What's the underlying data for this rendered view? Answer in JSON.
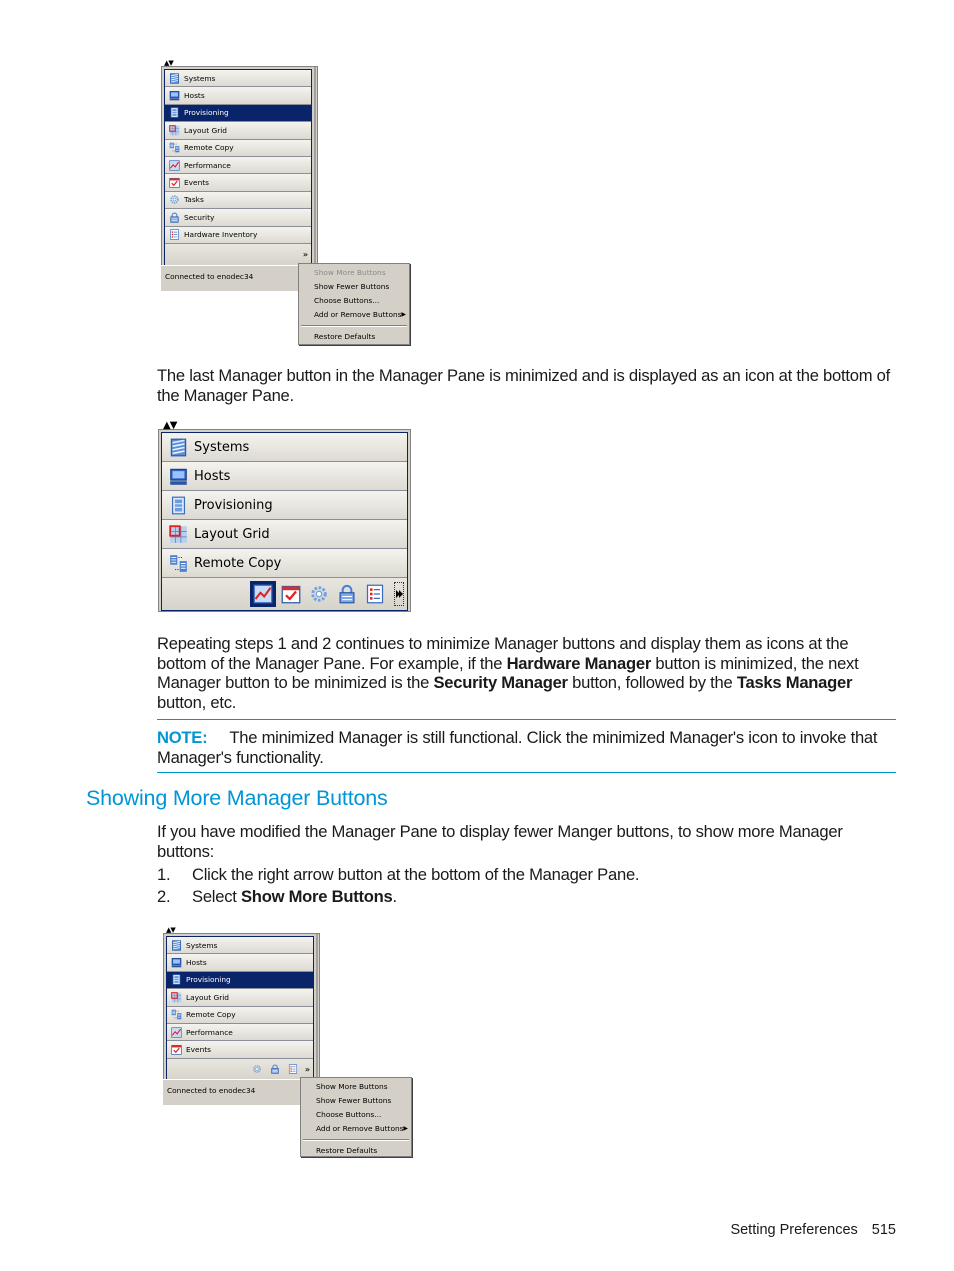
{
  "figure1": {
    "buttons": [
      {
        "label": "Systems",
        "icon": "systems-icon",
        "selected": false
      },
      {
        "label": "Hosts",
        "icon": "hosts-icon",
        "selected": false
      },
      {
        "label": "Provisioning",
        "icon": "provisioning-icon",
        "selected": true
      },
      {
        "label": "Layout Grid",
        "icon": "layout-grid-icon",
        "selected": false
      },
      {
        "label": "Remote Copy",
        "icon": "remote-copy-icon",
        "selected": false
      },
      {
        "label": "Performance",
        "icon": "performance-icon",
        "selected": false
      },
      {
        "label": "Events",
        "icon": "events-icon",
        "selected": false
      },
      {
        "label": "Tasks",
        "icon": "tasks-icon",
        "selected": false
      },
      {
        "label": "Security",
        "icon": "security-icon",
        "selected": false
      },
      {
        "label": "Hardware Inventory",
        "icon": "hardware-inventory-icon",
        "selected": false
      }
    ],
    "overflow_glyph": "»",
    "status": "Connected to enodec34",
    "menu": [
      {
        "label": "Show More Buttons",
        "disabled": true
      },
      {
        "label": "Show Fewer Buttons",
        "disabled": false
      },
      {
        "label": "Choose Buttons...",
        "disabled": false
      },
      {
        "label": "Add or Remove Buttons",
        "disabled": false,
        "submenu": true
      }
    ],
    "menu_after_sep": [
      {
        "label": "Restore Defaults",
        "disabled": false
      }
    ],
    "submenu_arrow": "▶"
  },
  "paragraph1": "The last Manager button in the Manager Pane is minimized and is displayed as an icon at the bottom of the Manager Pane.",
  "figure2": {
    "buttons": [
      {
        "label": "Systems",
        "icon": "systems-icon"
      },
      {
        "label": "Hosts",
        "icon": "hosts-icon"
      },
      {
        "label": "Provisioning",
        "icon": "provisioning-icon"
      },
      {
        "label": "Layout Grid",
        "icon": "layout-grid-icon"
      },
      {
        "label": "Remote Copy",
        "icon": "remote-copy-icon"
      }
    ],
    "minimized_icons": [
      "performance-icon",
      "events-icon",
      "tasks-icon",
      "security-icon",
      "hardware-inventory-icon"
    ],
    "active_minimized": "performance-icon"
  },
  "paragraph2": {
    "t1": "Repeating steps 1 and 2 continues to minimize Manager buttons and display them as icons at the bottom of the Manager Pane. For example, if the ",
    "b1": "Hardware Manager",
    "t2": " button is minimized, the next Manager button to be minimized is the ",
    "b2": "Security Manager",
    "t3": " button, followed by the ",
    "b3": "Tasks Manager",
    "t4": " button, etc."
  },
  "note": {
    "label": "NOTE:",
    "text": "The minimized Manager is still functional. Click the minimized Manager's icon to invoke that Manager's functionality."
  },
  "section": {
    "title": "Showing More Manager Buttons",
    "intro": "If you have modified the Manager Pane to display fewer Manger buttons, to show more Manager buttons:",
    "steps": [
      {
        "num": "1.",
        "text": "Click the right arrow button at the bottom of the Manager Pane.",
        "bold": ""
      },
      {
        "num": "2.",
        "text": "Select ",
        "bold": "Show More Buttons",
        "after": "."
      }
    ]
  },
  "figure3": {
    "buttons": [
      {
        "label": "Systems",
        "icon": "systems-icon",
        "selected": false
      },
      {
        "label": "Hosts",
        "icon": "hosts-icon",
        "selected": false
      },
      {
        "label": "Provisioning",
        "icon": "provisioning-icon",
        "selected": true
      },
      {
        "label": "Layout Grid",
        "icon": "layout-grid-icon",
        "selected": false
      },
      {
        "label": "Remote Copy",
        "icon": "remote-copy-icon",
        "selected": false
      },
      {
        "label": "Performance",
        "icon": "performance-icon",
        "selected": false
      },
      {
        "label": "Events",
        "icon": "events-icon",
        "selected": false
      }
    ],
    "minimized_icons": [
      "tasks-icon",
      "security-icon",
      "hardware-inventory-icon"
    ],
    "overflow_glyph": "»",
    "status": "Connected to enodec34",
    "menu": [
      {
        "label": "Show More Buttons",
        "disabled": false
      },
      {
        "label": "Show Fewer Buttons",
        "disabled": false
      },
      {
        "label": "Choose Buttons...",
        "disabled": false
      },
      {
        "label": "Add or Remove Buttons",
        "disabled": false,
        "submenu": true
      }
    ],
    "menu_after_sep": [
      {
        "label": "Restore Defaults",
        "disabled": false
      }
    ],
    "submenu_arrow": "▶"
  },
  "footer": {
    "section": "Setting Preferences",
    "page": "515"
  },
  "colors": {
    "accent": "#0096d6",
    "selected_button": "#0a246a",
    "pane_gray": "#d4d0c8"
  }
}
